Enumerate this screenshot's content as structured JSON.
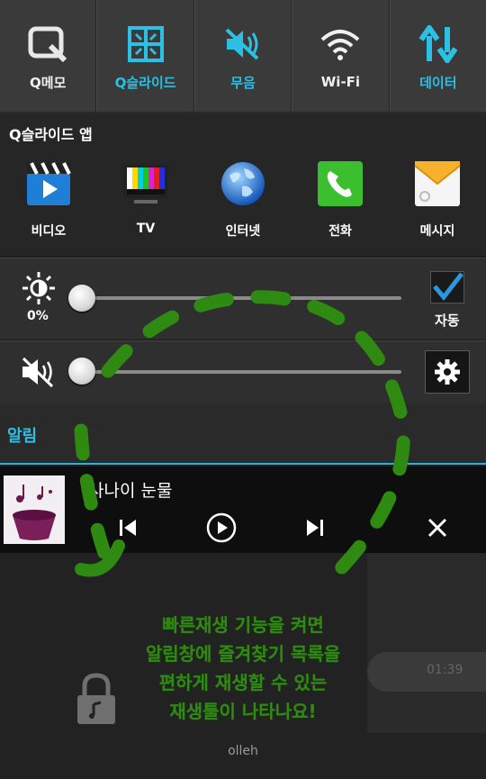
{
  "quick_toggles": [
    {
      "label": "Q메모",
      "icon": "qmemo-icon",
      "active": false
    },
    {
      "label": "Q슬라이드",
      "icon": "qslide-icon",
      "active": true
    },
    {
      "label": "무음",
      "icon": "mute-icon",
      "active": true
    },
    {
      "label": "Wi-Fi",
      "icon": "wifi-icon",
      "active": false
    },
    {
      "label": "데이터",
      "icon": "data-icon",
      "active": true
    }
  ],
  "qslide": {
    "title": "Q슬라이드 앱",
    "apps": [
      {
        "label": "비디오",
        "icon": "video-icon"
      },
      {
        "label": "TV",
        "icon": "tv-icon"
      },
      {
        "label": "인터넷",
        "icon": "internet-globe-icon"
      },
      {
        "label": "전화",
        "icon": "phone-icon"
      },
      {
        "label": "메시지",
        "icon": "message-icon"
      }
    ]
  },
  "brightness": {
    "percent_label": "0%",
    "level": 0,
    "auto_label": "자동",
    "auto_checked": true
  },
  "volume": {
    "level": 0
  },
  "notifications": {
    "header": "알림"
  },
  "player": {
    "song_title": "사나이 눈물"
  },
  "background": {
    "pill_text": "01:39"
  },
  "carrier": "olleh",
  "annotation": {
    "lines": [
      "빠른재생 기능을 켜면",
      "알림창에 즐겨찾기 목록을",
      "편하게 재생할 수 있는",
      "재생툴이 나타나요!"
    ]
  },
  "colors": {
    "accent": "#2bc0e4",
    "annotation_green": "#2f8a12"
  }
}
